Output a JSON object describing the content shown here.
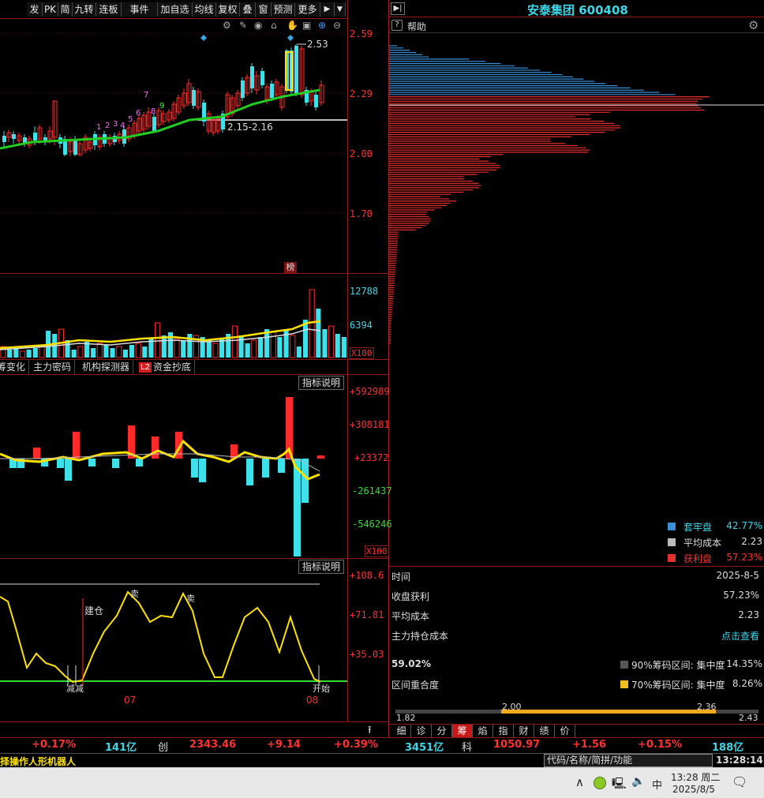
{
  "toolbar": {
    "items": [
      "发",
      "PK",
      "简",
      "九转",
      "连板",
      "事件",
      "加自选",
      "均线",
      "复权",
      "叠",
      "窗",
      "预测",
      "更多"
    ],
    "more_arrow": "▶",
    "dropdown": "▼"
  },
  "stock": {
    "name_code": "安泰集团 600408",
    "help": "帮助"
  },
  "price_chart": {
    "axis_labels": [
      "2.59",
      "2.29",
      "2.00",
      "1.70"
    ],
    "high_label": "2.53",
    "range_label": "2.15-2.16",
    "seq_numbers": [
      "1",
      "2",
      "3",
      "4",
      "5",
      "6",
      "7",
      "8",
      "9"
    ],
    "bang_label": "榜"
  },
  "volume_chart": {
    "axis_labels": [
      "12788",
      "6394"
    ],
    "unit": "X100"
  },
  "indicator_tabs": [
    "筹变化",
    "主力密码",
    "机构探测器",
    "资金抄底"
  ],
  "indicator_tab_badge": "L2",
  "fund_chart": {
    "button": "指标说明",
    "axis_labels": [
      "+592989",
      "+308181",
      "+23372",
      "-261437",
      "-546246"
    ],
    "unit": "X100"
  },
  "osc_chart": {
    "button": "指标说明",
    "axis_labels": [
      "+108.6",
      "+71.81",
      "+35.03"
    ],
    "jiancang": "建仓",
    "month_labels": [
      "07",
      "08"
    ],
    "marks": [
      "减",
      "减",
      "卖",
      "卖",
      "开始"
    ]
  },
  "chip_legend": [
    {
      "label": "套牢盘",
      "value": "42.77%",
      "color": "#3a8fd6"
    },
    {
      "label": "平均成本",
      "value": "2.23",
      "color": "#bbbbbb"
    },
    {
      "label": "获利盘",
      "value": "57.23%",
      "color": "#e53030"
    }
  ],
  "chip_info": {
    "rows": [
      {
        "k": "时间",
        "v": "2025-8-5"
      },
      {
        "k": "收盘获利",
        "v": "57.23%"
      },
      {
        "k": "平均成本",
        "v": "2.23"
      },
      {
        "k": "主力持仓成本",
        "v": "点击查看"
      }
    ],
    "overlap_pct": "59.02%",
    "overlap_label": "区间重合度",
    "c90_label": "90%筹码区间: 集中度",
    "c90_value": "14.35%",
    "c70_label": "70%筹码区间: 集中度",
    "c70_value": "8.26%",
    "range_low": "1.82",
    "range_high": "2.43",
    "range_bar_low": "2.00",
    "range_bar_high": "2.36"
  },
  "bottom_tabs": [
    "细",
    "诊",
    "分",
    "筹",
    "焰",
    "指",
    "财",
    "绩",
    "价"
  ],
  "ticker": {
    "t1": "+0.17%",
    "t2": "141亿",
    "t3": "创",
    "t4": "2343.46",
    "t5": "+9.14",
    "t6": "+0.39%",
    "t7": "3451亿",
    "t8": "科",
    "t9": "1050.97",
    "t10": "+1.56",
    "t11": "+0.15%",
    "t12": "188亿"
  },
  "status": {
    "marquee": "择操作人形机器人",
    "search_placeholder": "代码/名称/简拼/功能",
    "clock": "13:28:14"
  },
  "taskbar": {
    "ime": "中",
    "time": "13:28 周二",
    "date": "2025/8/5"
  }
}
